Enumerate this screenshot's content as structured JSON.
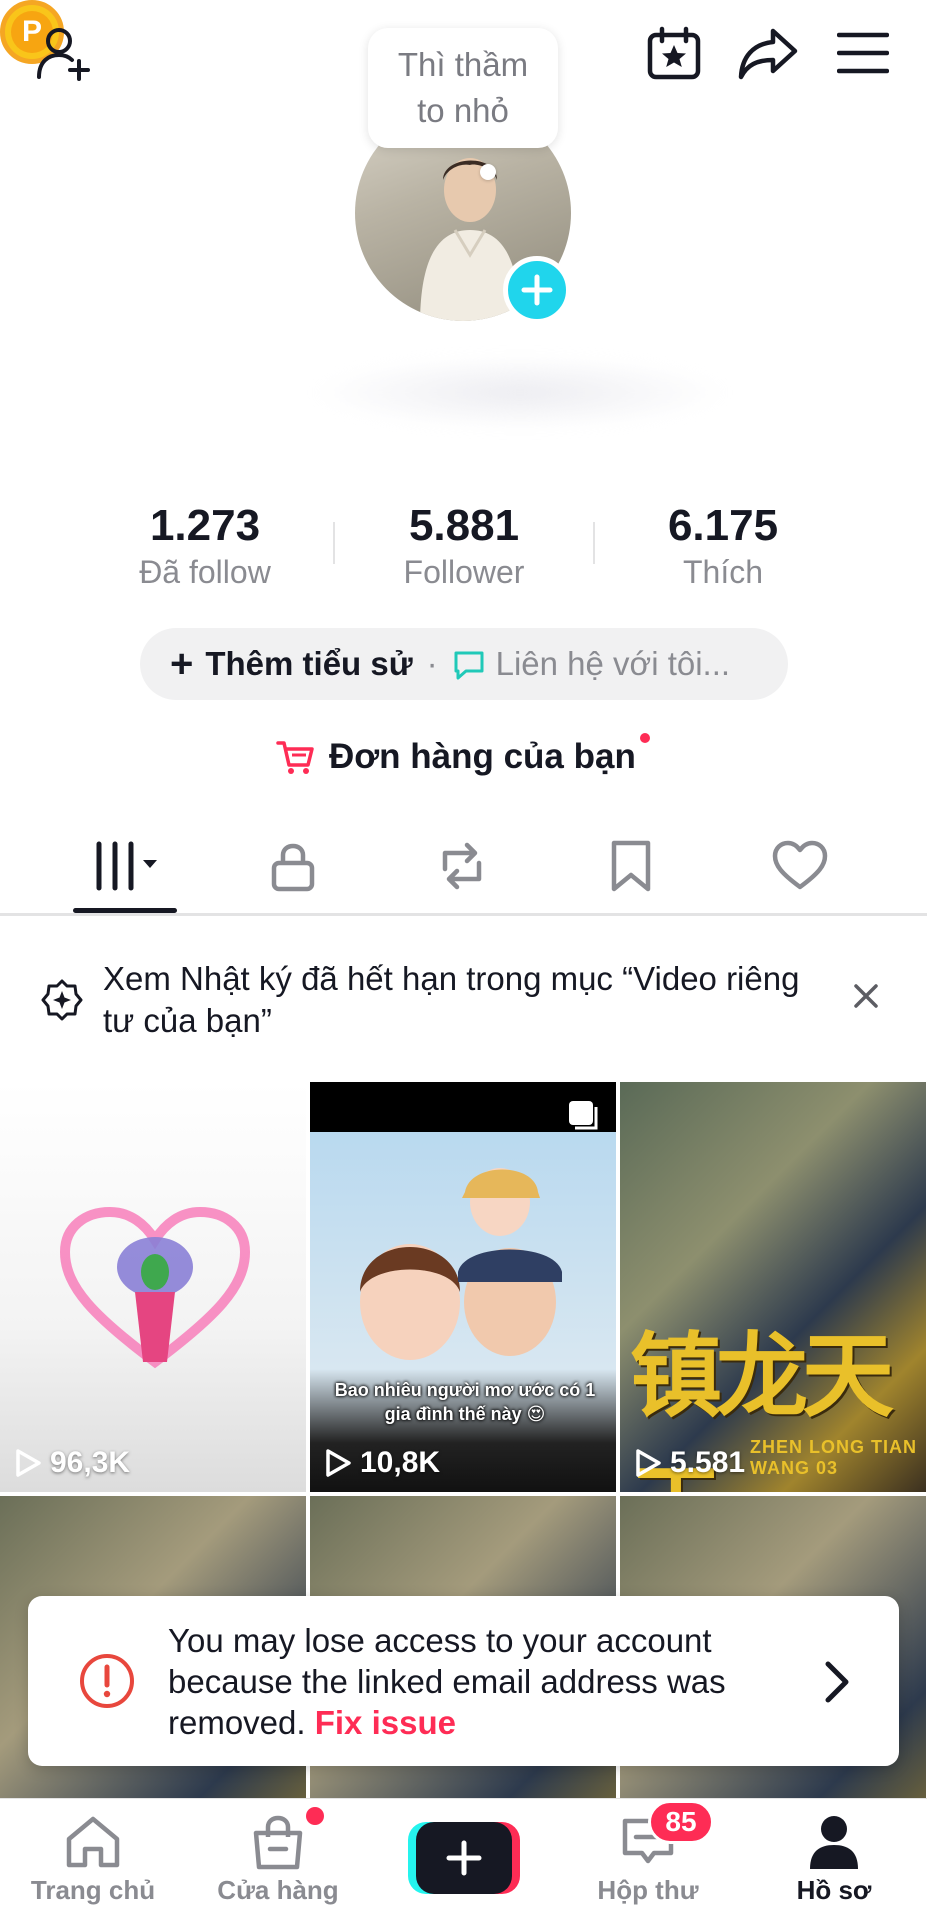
{
  "top_bar": {
    "coin_letter": "P"
  },
  "profile": {
    "bubble_text": "Thì thầm to nhỏ"
  },
  "stats": [
    {
      "value": "1.273",
      "label": "Đã follow"
    },
    {
      "value": "5.881",
      "label": "Follower"
    },
    {
      "value": "6.175",
      "label": "Thích"
    }
  ],
  "bio": {
    "add_label": "Thêm tiểu sử",
    "separator": "·",
    "contact_label": "Liên hệ với tôi..."
  },
  "orders": {
    "label": "Đơn hàng của bạn"
  },
  "banner": {
    "text": "Xem Nhật ký đã hết hạn trong mục “Video riêng tư của bạn”"
  },
  "videos": [
    {
      "views": "96,3K"
    },
    {
      "views": "10,8K",
      "caption": "Bao nhiêu người mơ ước có 1 gia đình thế này 😍"
    },
    {
      "views": "5.581",
      "title": "镇龙天王",
      "subtitle": "ZHEN LONG TIAN WANG 03"
    },
    {
      "views": ""
    },
    {
      "views": ""
    },
    {
      "views": ""
    }
  ],
  "warning": {
    "text": "You may lose access to your account because the linked email address was removed.",
    "link": "Fix issue"
  },
  "bottom_nav": {
    "home": "Trang chủ",
    "shop": "Cửa hàng",
    "inbox": "Hộp thư",
    "inbox_badge": "85",
    "profile": "Hồ sơ"
  },
  "colors": {
    "accent": "#fe2c55",
    "cyan": "#25f4ee",
    "text": "#161823",
    "muted": "#8a8b91"
  }
}
